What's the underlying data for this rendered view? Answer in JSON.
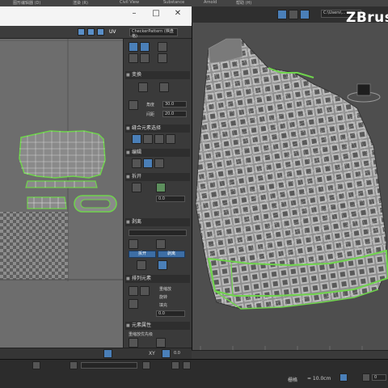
{
  "menubar": {
    "items": [
      "图形编辑器 (D)",
      "渲染 (R)",
      "Civil View",
      "Substance",
      "Arnold",
      "帮助 (H)"
    ]
  },
  "uv_editor": {
    "window_buttons": [
      "–",
      "□",
      "✕"
    ],
    "toolbar_label": "UV",
    "dropdown_value": "CheckerPattern (棋盘格)",
    "panel": {
      "sections": [
        {
          "title": "变换"
        },
        {
          "title": "缝合元素选择"
        },
        {
          "title": "编辑"
        },
        {
          "title": "拆开"
        },
        {
          "title": "剥离"
        },
        {
          "title": "排列元素"
        },
        {
          "title": "元素属性"
        }
      ],
      "transform": {
        "angle_label": "角度",
        "angle_value": "30.0",
        "spacing_label": "间距",
        "spacing_value": "20.0"
      },
      "peel": {
        "value": "0.0"
      },
      "pack": {
        "rescale_label": "重缩放",
        "rotate_label": "旋转",
        "padding_label": "填充",
        "padding_value": "0.0"
      },
      "element_props": {
        "label": "重缩放优先级"
      },
      "blue_buttons": [
        "拆开",
        "剥离"
      ]
    },
    "status": {
      "axis": "XY",
      "zoom": "0.0"
    }
  },
  "viewport": {
    "brand": "ZBrus",
    "path_label": "C:\\Users\\…"
  },
  "status_bar": {
    "grid_label": "栅格",
    "grid_value": "= 10.0cm",
    "time_value": "0"
  },
  "colors": {
    "accent_blue": "#3d6ea5",
    "uv_green": "#6fd44c",
    "background": "#2b2b2b"
  }
}
